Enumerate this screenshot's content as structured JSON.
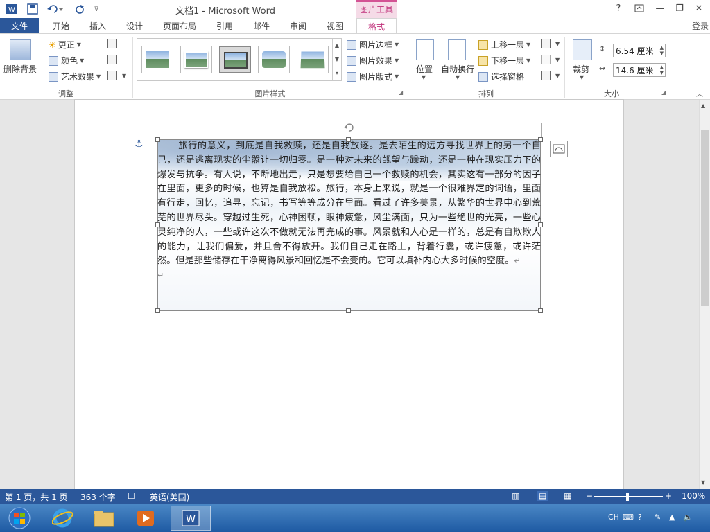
{
  "titlebar": {
    "title": "文档1 - Microsoft Word",
    "context_label": "图片工具",
    "help": "?",
    "min": "—",
    "restore": "❐",
    "close": "✕"
  },
  "tabs": {
    "file": "文件",
    "items": [
      "开始",
      "插入",
      "设计",
      "页面布局",
      "引用",
      "邮件",
      "审阅",
      "视图"
    ],
    "format": "格式",
    "login": "登录"
  },
  "ribbon": {
    "adjust": {
      "remove_bg": "删除背景",
      "corrections": "更正",
      "color": "颜色",
      "artistic": "艺术效果",
      "label": "调整"
    },
    "styles": {
      "border": "图片边框",
      "effects": "图片效果",
      "layout": "图片版式",
      "label": "图片样式"
    },
    "arrange": {
      "position": "位置",
      "wrap": "自动换行",
      "forward": "上移一层",
      "backward": "下移一层",
      "pane": "选择窗格",
      "label": "排列"
    },
    "size": {
      "crop": "裁剪",
      "height": "6.54 厘米",
      "width": "14.6 厘米",
      "label": "大小"
    }
  },
  "document": {
    "body": "旅行的意义，到底是自我救赎，还是自我放逐。是去陌生的远方寻找世界上的另一个自己，还是逃离现实的尘嚣让一切归零。是一种对未来的觊望与躁动，还是一种在现实压力下的爆发与抗争。有人说，不断地出走，只是想要给自己一个救赎的机会，其实这有一部分的因子在里面，更多的时候，也算是自我放松。旅行，本身上来说，就是一个很难界定的词语，里面有行走，回忆，追寻，忘记，书写等等成分在里面。看过了许多美景，从繁华的世界中心到荒芜的世界尽头。穿越过生死，心神困顿，眼神疲惫，风尘满面，只为一些绝世的光亮，一些心灵纯净的人，一些或许这次不做就无法再完成的事。风景就和人心是一样的，总是有自欺欺人的能力，让我们偏爱，并且舍不得放开。我们自己走在路上，背着行囊，或许疲惫，或许茫然。但是那些储存在干净离得风景和回忆是不会变的。它可以填补内心大多时候的空度。",
    "para_mark": "↵",
    "empty_mark": "↵"
  },
  "status": {
    "page": "第 1 页，共 1 页",
    "words": "363 个字",
    "language": "英语(美国)",
    "zoom": "100%",
    "zoom_minus": "−",
    "zoom_plus": "+"
  },
  "taskbar": {
    "ime": "CH"
  },
  "colors": {
    "accent": "#2b579a",
    "context": "#c0307a"
  }
}
